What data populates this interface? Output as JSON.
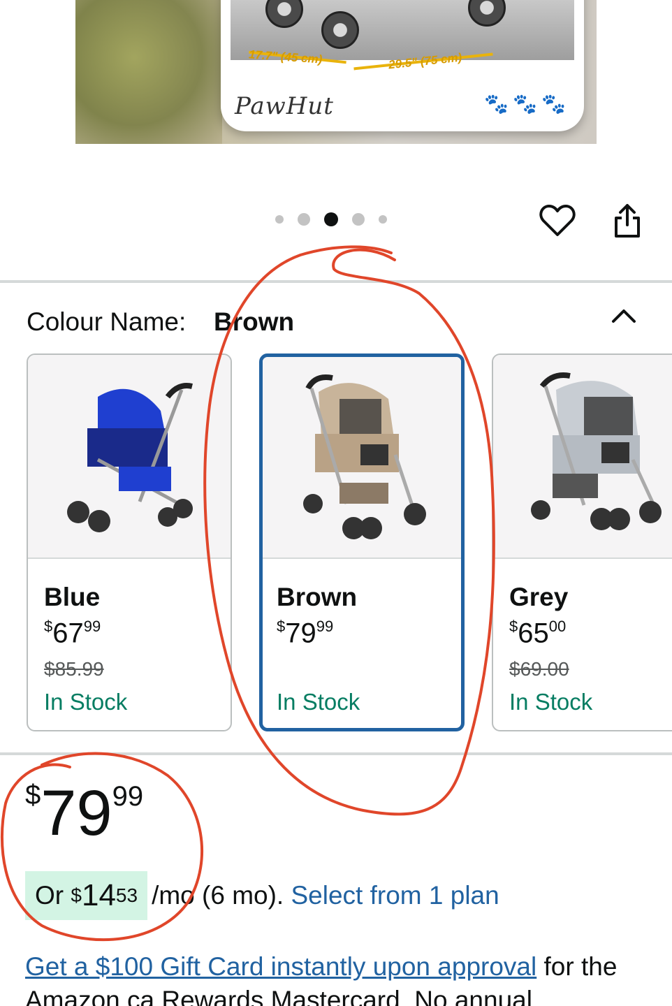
{
  "hero": {
    "brand": "PawHut",
    "dimension_width": "17.7\" (45 cm)",
    "dimension_length": "29.5\" (75 cm)",
    "paws": "🐾🐾🐾"
  },
  "carousel": {
    "total_dots": 5,
    "active_index": 2
  },
  "actions": {
    "favorite_icon": "heart-icon",
    "share_icon": "share-icon"
  },
  "colour": {
    "label": "Colour Name:",
    "selected": "Brown",
    "options": [
      {
        "name": "Blue",
        "currency": "$",
        "whole": "67",
        "fraction": "99",
        "was": "$85.99",
        "stock": "In Stock",
        "color": "#1f3fd0"
      },
      {
        "name": "Brown",
        "currency": "$",
        "whole": "79",
        "fraction": "99",
        "was": "",
        "stock": "In Stock",
        "color": "#c8b49a"
      },
      {
        "name": "Grey",
        "currency": "$",
        "whole": "65",
        "fraction": "00",
        "was": "$69.00",
        "stock": "In Stock",
        "color": "#c8cdd3"
      }
    ]
  },
  "price": {
    "currency": "$",
    "whole": "79",
    "fraction": "99",
    "monthly_prefix": "Or",
    "monthly_currency": "$",
    "monthly_whole": "14",
    "monthly_fraction": "53",
    "monthly_suffix": "/mo (6 mo).",
    "plan_link": "Select from 1 plan"
  },
  "promo": {
    "link_text": "Get a $100 Gift Card instantly upon approval",
    "rest_text": " for the Amazon.ca Rewards Mastercard. No annual"
  },
  "colors": {
    "link": "#2162a1",
    "in_stock": "#067d62",
    "selected_border": "#2162a1",
    "installment_bg": "#d3f4e4",
    "annotation": "#e0462a"
  }
}
